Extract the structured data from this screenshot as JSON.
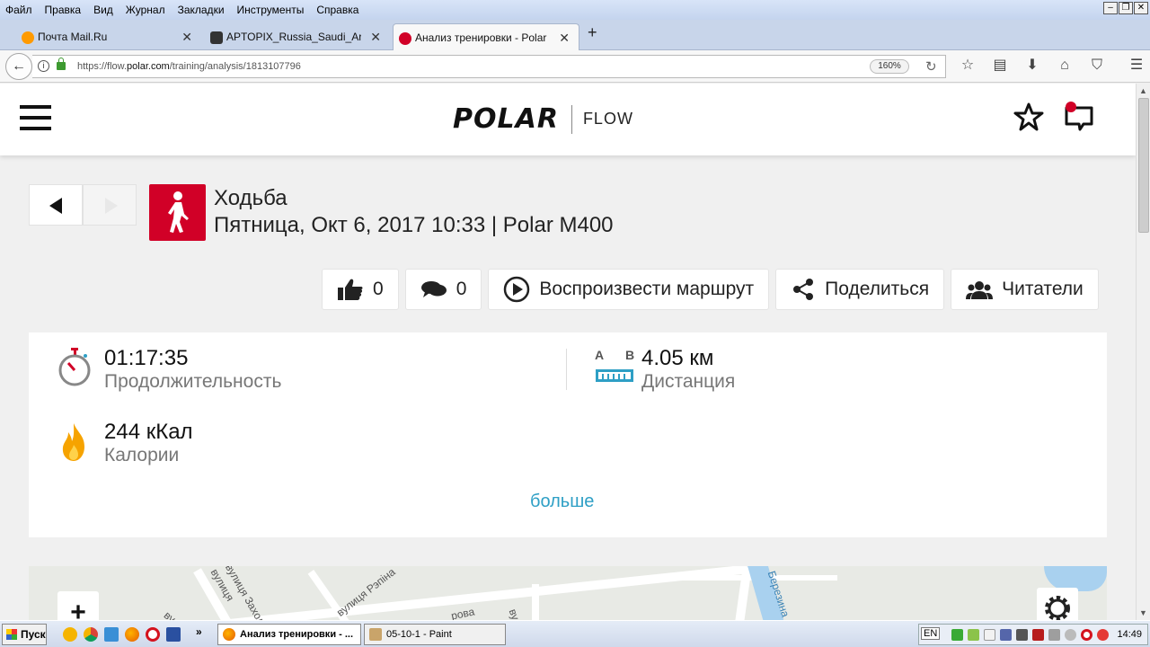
{
  "menubar": {
    "items": [
      "Файл",
      "Правка",
      "Вид",
      "Журнал",
      "Закладки",
      "Инструменты",
      "Справка"
    ]
  },
  "tabs": [
    {
      "label": "Почта Mail.Ru",
      "favicon_color": "#ff9a00"
    },
    {
      "label": "APTOPIX_Russia_Saudi_Arabi...",
      "favicon_color": "#333333"
    },
    {
      "label": "Анализ тренировки - Polar F...",
      "favicon_color": "#d10027",
      "active": true
    }
  ],
  "navbar": {
    "url_prefix": "https://flow.",
    "url_domain": "polar.com",
    "url_path": "/training/analysis/1813107796",
    "zoom": "160%"
  },
  "site": {
    "brand_logo": "POLAR",
    "brand_sub": "FLOW",
    "accent_color": "#d10027",
    "link_color": "#2e9fc5"
  },
  "session": {
    "title": "Ходьба",
    "subtitle": "Пятница, Окт 6, 2017 10:33 | Polar M400",
    "sport_icon": "walking-person-icon"
  },
  "actions": {
    "likes": "0",
    "comments": "0",
    "replay": "Воспроизвести маршрут",
    "share": "Поделиться",
    "followers": "Читатели"
  },
  "summary": {
    "duration_value": "01:17:35",
    "duration_label": "Продолжительность",
    "distance_value": "4.05 км",
    "distance_label": "Дистанция",
    "distance_a": "A",
    "distance_b": "B",
    "calories_value": "244 кКал",
    "calories_label": "Калории",
    "more": "больше"
  },
  "map": {
    "zoom_in": "+",
    "labels": [
      "вулиця",
      "вулиця Заходня",
      "вулиця Рэпіна",
      "вул",
      "рова",
      "Березина",
      "вул"
    ]
  },
  "taskbar": {
    "start": "Пуск",
    "tasks": [
      {
        "label": "Анализ тренировки - ...",
        "active": true
      },
      {
        "label": "05-10-1 - Paint",
        "active": false
      }
    ],
    "lang": "EN",
    "clock": "14:49"
  }
}
